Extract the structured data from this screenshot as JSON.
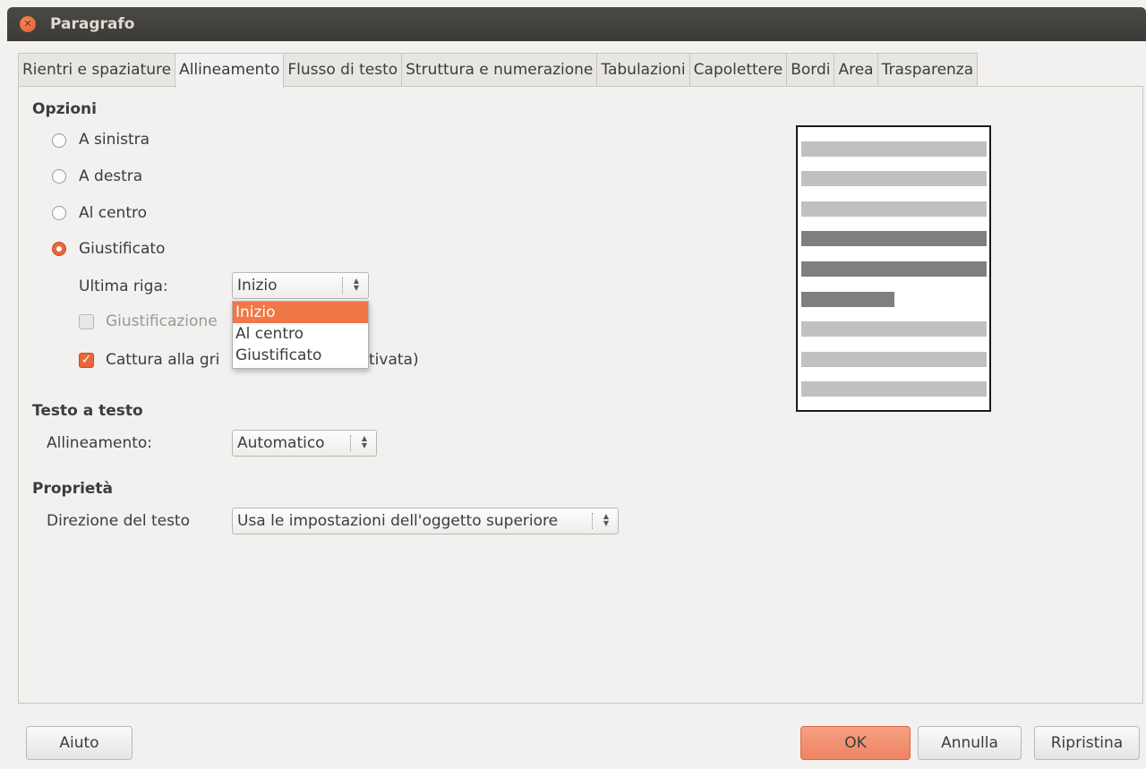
{
  "window": {
    "title": "Paragrafo"
  },
  "tabs": [
    {
      "label": "Rientri e spaziature"
    },
    {
      "label": "Allineamento"
    },
    {
      "label": "Flusso di testo"
    },
    {
      "label": "Struttura e numerazione"
    },
    {
      "label": "Tabulazioni"
    },
    {
      "label": "Capolettere"
    },
    {
      "label": "Bordi"
    },
    {
      "label": "Area"
    },
    {
      "label": "Trasparenza"
    }
  ],
  "active_tab": "Allineamento",
  "options": {
    "heading": "Opzioni",
    "radios": [
      {
        "label": "A sinistra",
        "checked": false
      },
      {
        "label": "A destra",
        "checked": false
      },
      {
        "label": "Al centro",
        "checked": false
      },
      {
        "label": "Giustificato",
        "checked": true
      }
    ],
    "last_line_label": "Ultima riga:",
    "last_line_value": "Inizio",
    "last_line_options": [
      "Inizio",
      "Al centro",
      "Giustificato"
    ],
    "expand_word_label": "Giustificazione",
    "snap_label_left": "Cattura alla gri",
    "snap_label_right": "tivata)"
  },
  "text_to_text": {
    "heading": "Testo a testo",
    "alignment_label": "Allineamento:",
    "alignment_value": "Automatico"
  },
  "properties": {
    "heading": "Proprietà",
    "direction_label": "Direzione del testo",
    "direction_value": "Usa le impostazioni dell'oggetto superiore"
  },
  "buttons": {
    "help": "Aiuto",
    "ok": "OK",
    "cancel": "Annulla",
    "reset": "Ripristina"
  },
  "colors": {
    "accent": "#e8673b",
    "selection": "#f07746",
    "titlebar": "#3c3b37"
  }
}
